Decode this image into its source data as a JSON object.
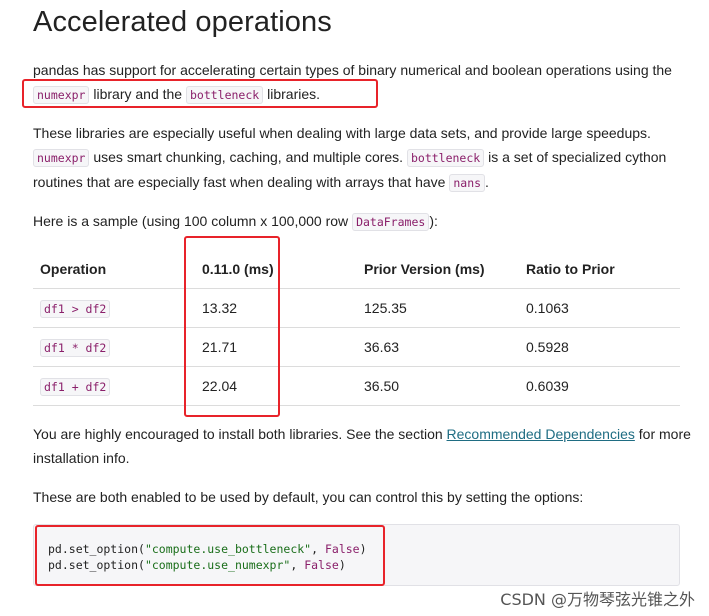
{
  "title": "Accelerated operations",
  "intro": {
    "t1": "pandas has support for accelerating certain types of binary numerical and boolean operations using the ",
    "code1": "numexpr",
    "t2": " library and the ",
    "code2": "bottleneck",
    "t3": " libraries."
  },
  "details": {
    "t1": "These libraries are especially useful when dealing with large data sets, and provide large speedups. ",
    "code1": "numexpr",
    "t2": " uses smart chunking, caching, and multiple cores. ",
    "code2": "bottleneck",
    "t3": " is a set of specialized cython routines that are especially fast when dealing with arrays that have ",
    "code3": "nans",
    "t4": "."
  },
  "sample": {
    "t1": "Here is a sample (using 100 column x 100,000 row ",
    "code1": "DataFrames",
    "t2": "):"
  },
  "table": {
    "headers": [
      "Operation",
      "0.11.0 (ms)",
      "Prior Version (ms)",
      "Ratio to Prior"
    ],
    "rows": [
      [
        "df1 > df2",
        "13.32",
        "125.35",
        "0.1063"
      ],
      [
        "df1 * df2",
        "21.71",
        "36.63",
        "0.5928"
      ],
      [
        "df1 + df2",
        "22.04",
        "36.50",
        "0.6039"
      ]
    ]
  },
  "encourage": {
    "t1": "You are highly encouraged to install both libraries. See the section ",
    "link": "Recommended Dependencies",
    "t2": " for more installation info."
  },
  "defaults_text": "These are both enabled to be used by default, you can control this by setting the options:",
  "code": {
    "line1_fn": "pd.set_option(",
    "line1_str": "\"compute.use_bottleneck\"",
    "line1_sep": ", ",
    "line1_kw": "False",
    "line1_end": ")",
    "line2_fn": "pd.set_option(",
    "line2_str": "\"compute.use_numexpr\"",
    "line2_sep": ", ",
    "line2_kw": "False",
    "line2_end": ")"
  },
  "watermark": "CSDN @万物琴弦光锥之外",
  "colors": {
    "highlight_box": "#e8232a",
    "link": "#1f6d83",
    "code_text": "#8a1f6a"
  }
}
